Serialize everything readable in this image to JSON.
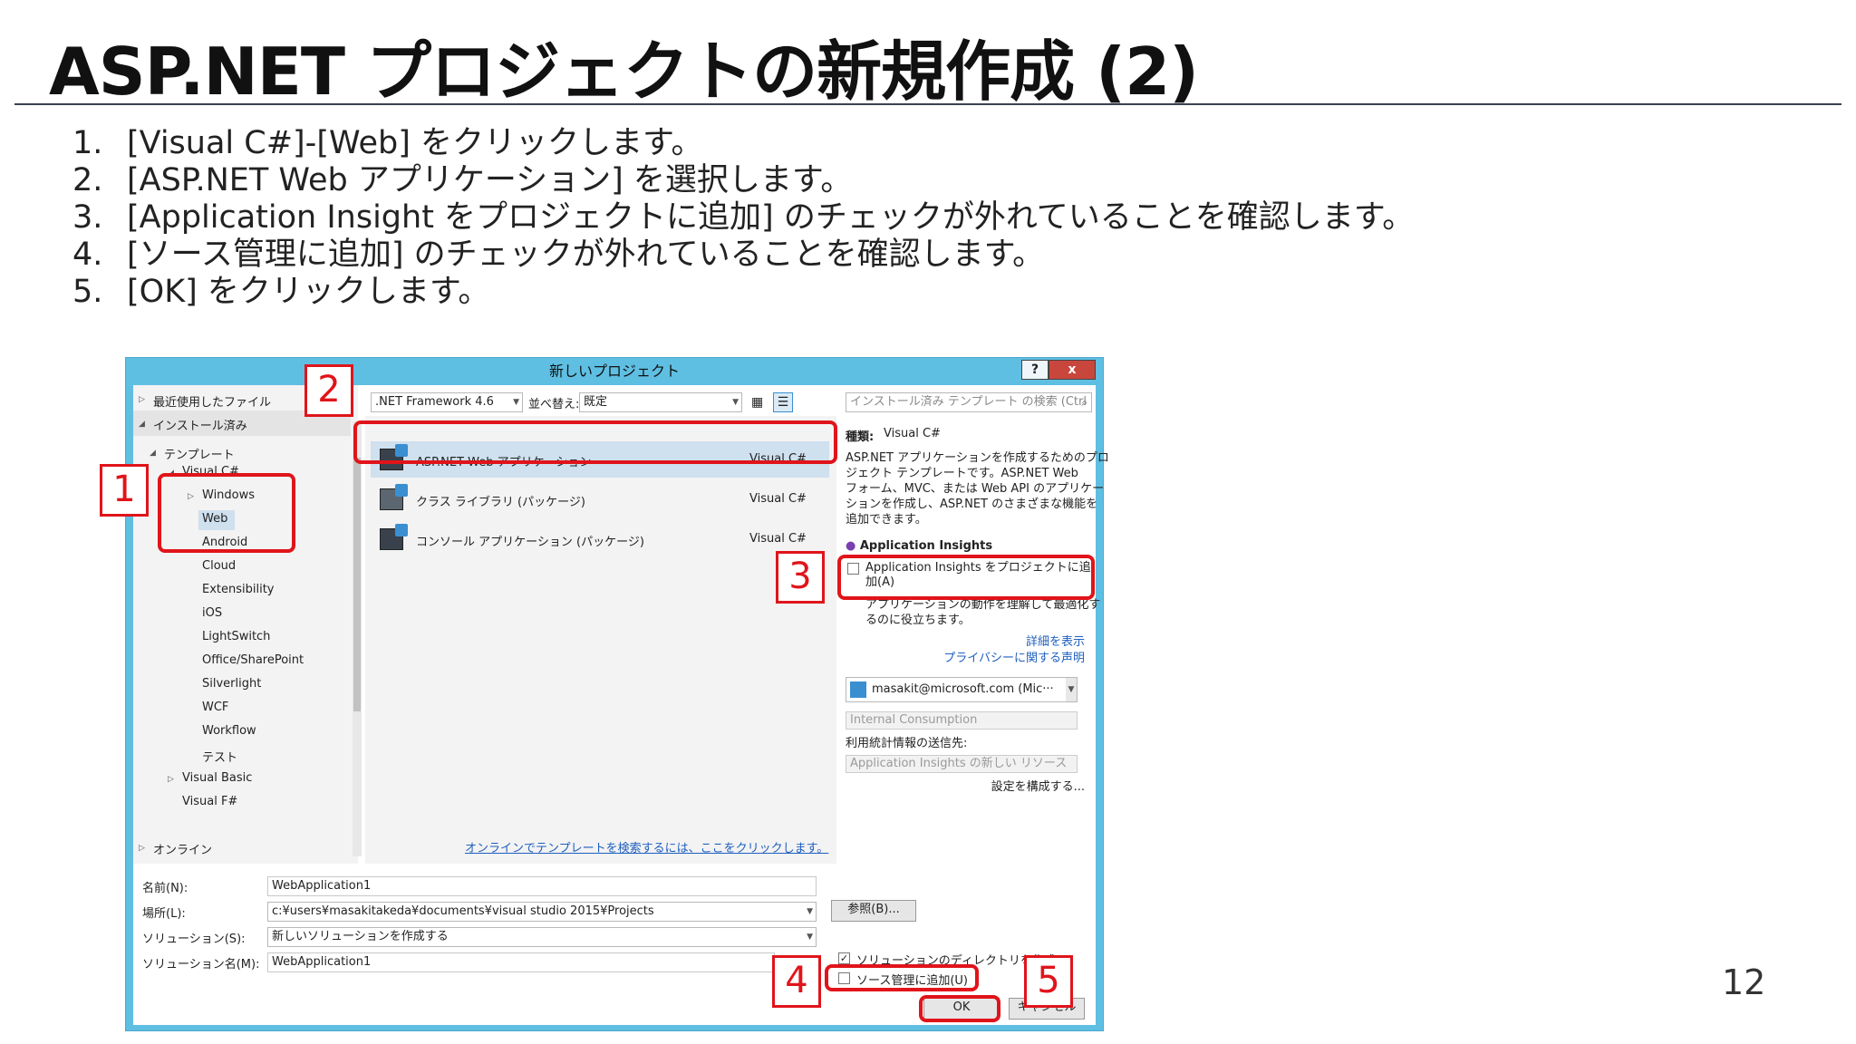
{
  "slide": {
    "title": "ASP.NET プロジェクトの新規作成 (2)",
    "steps": [
      {
        "num": "1.",
        "text": "[Visual C#]-[Web] をクリックします。"
      },
      {
        "num": "2.",
        "text": "[ASP.NET Web アプリケーション] を選択します。"
      },
      {
        "num": "3.",
        "text": "[Application Insight をプロジェクトに追加] のチェックが外れていることを確認します。"
      },
      {
        "num": "4.",
        "text": "[ソース管理に追加] のチェックが外れていることを確認します。"
      },
      {
        "num": "5.",
        "text": "[OK] をクリックします。"
      }
    ],
    "page_number": "12"
  },
  "dialog": {
    "title": "新しいプロジェクト",
    "help": "?",
    "close": "x",
    "tree": {
      "recent": "最近使用したファイル",
      "installed": "インストール済み",
      "templates": "テンプレート",
      "visual_csharp": "Visual C#",
      "windows": "Windows",
      "web": "Web",
      "android": "Android",
      "cloud": "Cloud",
      "extensibility": "Extensibility",
      "ios": "iOS",
      "lightswitch": "LightSwitch",
      "office": "Office/SharePoint",
      "silverlight": "Silverlight",
      "wcf": "WCF",
      "workflow": "Workflow",
      "test": "テスト",
      "visual_basic": "Visual Basic",
      "visual_fsharp": "Visual F#",
      "online": "オンライン"
    },
    "toolbar": {
      "framework": ".NET Framework 4.6",
      "sort_label": "並べ替え:",
      "sort_value": "既定",
      "search_placeholder": "インストール済み テンプレート の検索 (Ctrl"
    },
    "templates": [
      {
        "name": "ASP.NET Web アプリケーション",
        "lang": "Visual C#"
      },
      {
        "name": "クラス ライブラリ (パッケージ)",
        "lang": "Visual C#"
      },
      {
        "name": "コンソール アプリケーション (パッケージ)",
        "lang": "Visual C#"
      }
    ],
    "online_link": "オンラインでテンプレートを検索するには、ここをクリックします。",
    "details": {
      "type_label": "種類:",
      "type_value": "Visual C#",
      "description": [
        "ASP.NET アプリケーションを作成するためのプロ",
        "ジェクト テンプレートです。ASP.NET Web",
        "フォーム、MVC、または Web API のアプリケー",
        "ションを作成し、ASP.NET のさまざまな機能を",
        "追加できます。"
      ],
      "ai_header": "Application Insights",
      "ai_checkbox": "Application Insights をプロジェクトに追",
      "ai_checkbox_2": "加(A)",
      "ai_desc": [
        "アプリケーションの動作を理解して最適化す",
        "るのに役立ちます。"
      ],
      "more_link": "詳細を表示",
      "privacy_link": "プライバシーに関する声明",
      "account": "masakit@microsoft.com (Mic···",
      "subscription": "Internal Consumption",
      "telemetry_label": "利用統計情報の送信先:",
      "resource": "Application Insights の新しい リソース",
      "configure": "設定を構成する..."
    },
    "form": {
      "name_label": "名前(N):",
      "name_value": "WebApplication1",
      "location_label": "場所(L):",
      "location_value": "c:¥users¥masakitakeda¥documents¥visual studio 2015¥Projects",
      "solution_label": "ソリューション(S):",
      "solution_value": "新しいソリューションを作成する",
      "solution_name_label": "ソリューション名(M):",
      "solution_name_value": "WebApplication1",
      "browse": "参照(B)...",
      "create_dir": "ソリューションのディレクトリを作成(D)",
      "add_source": "ソース管理に追加(U)",
      "ok": "OK",
      "cancel": "キャンセル"
    }
  },
  "annotations": [
    "1",
    "2",
    "3",
    "4",
    "5"
  ],
  "colors": {
    "annotation_red": "#e0141a",
    "dialog_frame": "#5fbfe2",
    "selection": "#cfe0ef",
    "link": "#1f5fbf"
  }
}
